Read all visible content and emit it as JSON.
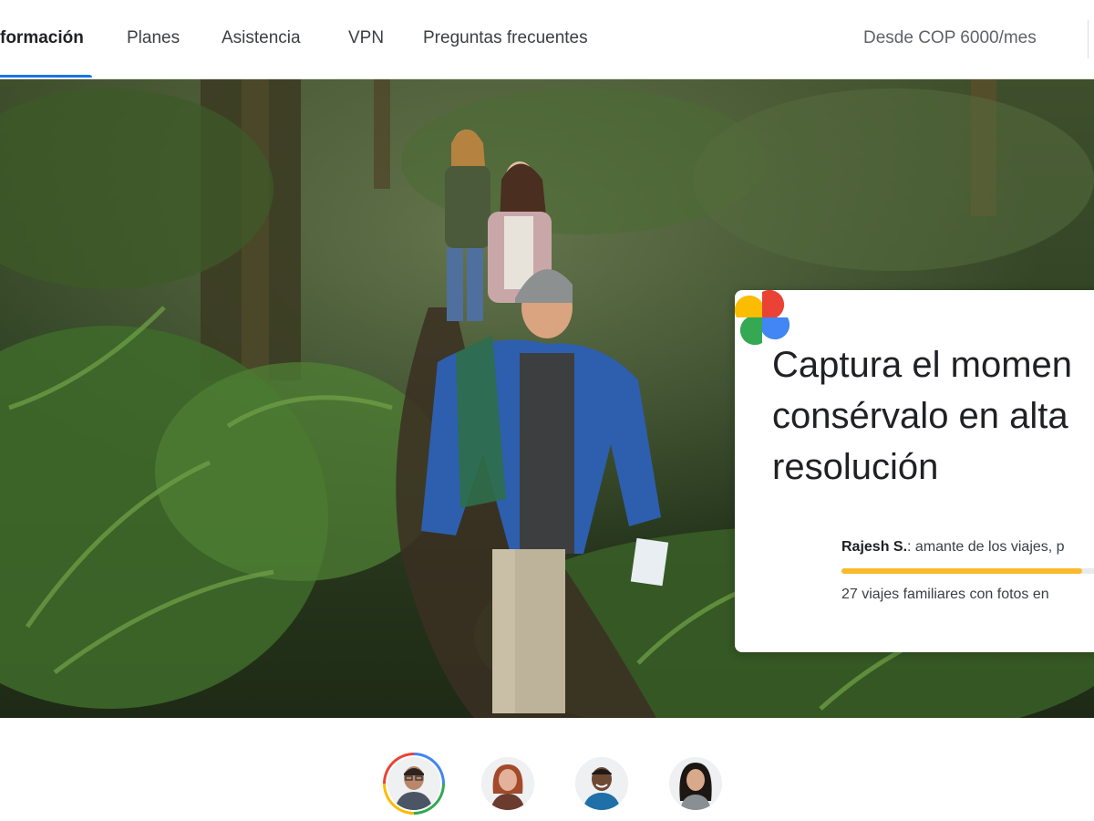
{
  "nav": {
    "tabs": [
      {
        "label": "formación",
        "active": true
      },
      {
        "label": "Planes",
        "active": false
      },
      {
        "label": "Asistencia",
        "active": false
      },
      {
        "label": "VPN",
        "active": false
      },
      {
        "label": "Preguntas frecuentes",
        "active": false
      }
    ],
    "price_label": "Desde COP 6000/mes"
  },
  "hero": {
    "image": "hikers-forest-photo",
    "card": {
      "headline_lines": [
        "Captura el momen",
        "consérvalo en alta",
        "resolución"
      ],
      "logo_icon": "google-photos-pinwheel-icon",
      "author_name": "Rajesh S.",
      "author_desc": ": amante de los viajes, p",
      "progress_fraction": 0.88,
      "progress_color": "#f9bb2d",
      "subline": "27 viajes familiares con fotos en"
    }
  },
  "avatars": [
    {
      "name": "avatar-man-glasses",
      "selected": true
    },
    {
      "name": "avatar-woman-red-hair",
      "selected": false
    },
    {
      "name": "avatar-man-smiling",
      "selected": false
    },
    {
      "name": "avatar-woman-dark-hair",
      "selected": false
    }
  ],
  "colors": {
    "accent": "#1a73e8",
    "google_blue": "#4285f4",
    "google_red": "#ea4335",
    "google_yellow": "#fbbc04",
    "google_green": "#34a853"
  }
}
